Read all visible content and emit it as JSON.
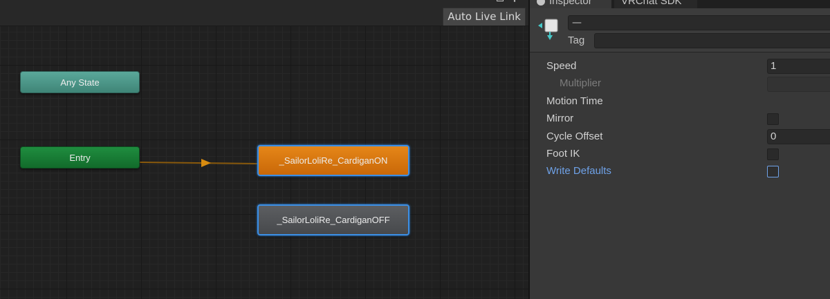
{
  "toolbar": {
    "auto_live_link_label": "Auto Live Link"
  },
  "graph": {
    "nodes": {
      "any_state": "Any State",
      "entry": "Entry",
      "cardigan_on": "_SailorLoliRe_CardiganON",
      "cardigan_off": "_SailorLoliRe_CardiganOFF"
    },
    "colors": {
      "any_state": "#4f9a8c",
      "entry": "#198038",
      "default_state": "#d97710",
      "state": "#55575a",
      "selection": "#3b8fe6",
      "transition": "#b87a10"
    }
  },
  "inspector": {
    "tabs": [
      "Inspector",
      "VRChat SDK"
    ],
    "name_value": "—",
    "tag_label": "Tag",
    "tag_value": "",
    "properties": {
      "speed_label": "Speed",
      "speed_value": "1",
      "multiplier_label": "Multiplier",
      "motion_time_label": "Motion Time",
      "mirror_label": "Mirror",
      "mirror_checked": false,
      "cycle_offset_label": "Cycle Offset",
      "cycle_offset_value": "0",
      "foot_ik_label": "Foot IK",
      "foot_ik_checked": false,
      "write_defaults_label": "Write Defaults",
      "write_defaults_checked": false
    }
  }
}
